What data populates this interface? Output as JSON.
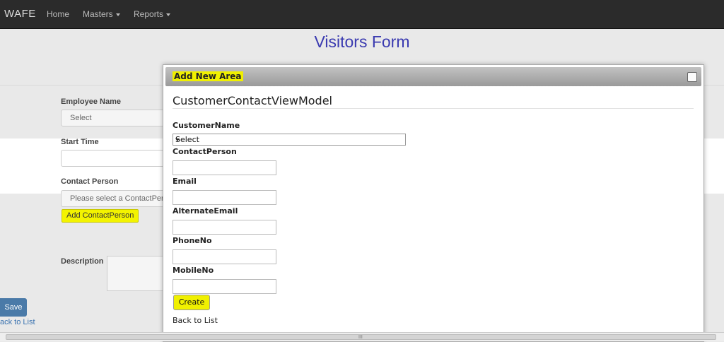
{
  "navbar": {
    "brand": "WAFE",
    "items": [
      {
        "label": "Home"
      },
      {
        "label": "Masters"
      },
      {
        "label": "Reports"
      }
    ]
  },
  "page": {
    "title": "Visitors Form",
    "fields": {
      "employee_name_label": "Employee Name",
      "employee_name_value": "Select",
      "start_time_label": "Start Time",
      "contact_person_label": "Contact Person",
      "contact_person_placeholder": "Please select a ContactPer",
      "add_contact_person": "Add ContactPerson",
      "description_label": "Description"
    },
    "save_label": "Save",
    "back_label": "ack to List"
  },
  "modal": {
    "title": "Add New Area",
    "heading": "CustomerContactViewModel",
    "customer_name_label": "CustomerName",
    "customer_name_value": "Select",
    "contact_person_label": "ContactPerson",
    "email_label": "Email",
    "alternate_email_label": "AlternateEmail",
    "phone_label": "PhoneNo",
    "mobile_label": "MobileNo",
    "create_label": "Create",
    "back_label": "Back to List"
  },
  "colors": {
    "highlight": "#f0f000",
    "navbar": "#2b2b2b",
    "title": "#3a3ab0",
    "save_button": "#4a7aa8"
  },
  "scrollbar_grip": "III"
}
